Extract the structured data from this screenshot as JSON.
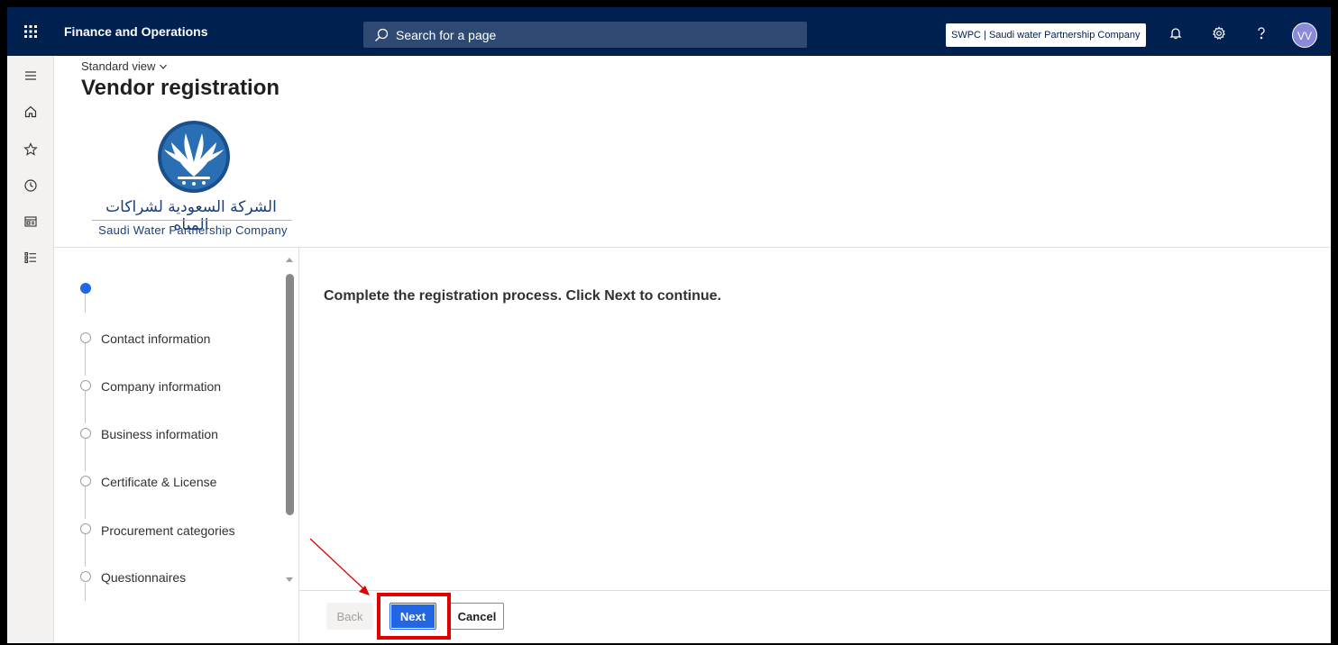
{
  "app": {
    "title": "Finance and Operations"
  },
  "search": {
    "placeholder": "Search for a page"
  },
  "company": {
    "label": "SWPC | Saudi water Partnership Company"
  },
  "user": {
    "initials": "VV"
  },
  "header": {
    "view_label": "Standard view",
    "title": "Vendor registration"
  },
  "logo": {
    "arabic_text": "الشركة السعودية لشراكات المياه",
    "english_text": "Saudi Water Partnership Company"
  },
  "steps": [
    {
      "label": "",
      "active": true
    },
    {
      "label": "Contact information",
      "active": false
    },
    {
      "label": "Company information",
      "active": false
    },
    {
      "label": "Business information",
      "active": false
    },
    {
      "label": "Certificate & License",
      "active": false
    },
    {
      "label": "Procurement categories",
      "active": false
    },
    {
      "label": "Questionnaires",
      "active": false
    }
  ],
  "content": {
    "message": "Complete the registration process. Click Next to continue."
  },
  "footer": {
    "back_label": "Back",
    "next_label": "Next",
    "cancel_label": "Cancel"
  },
  "icons": {
    "app_launcher": "waffle-icon",
    "search": "search-icon",
    "notifications": "bell-icon",
    "settings": "gear-icon",
    "help": "question-icon",
    "rail": [
      "hamburger-icon",
      "home-icon",
      "star-icon",
      "clock-icon",
      "workspace-icon",
      "modules-icon"
    ]
  },
  "colors": {
    "navbar": "#002050",
    "accent": "#2266e3",
    "highlight": "#e00000"
  }
}
